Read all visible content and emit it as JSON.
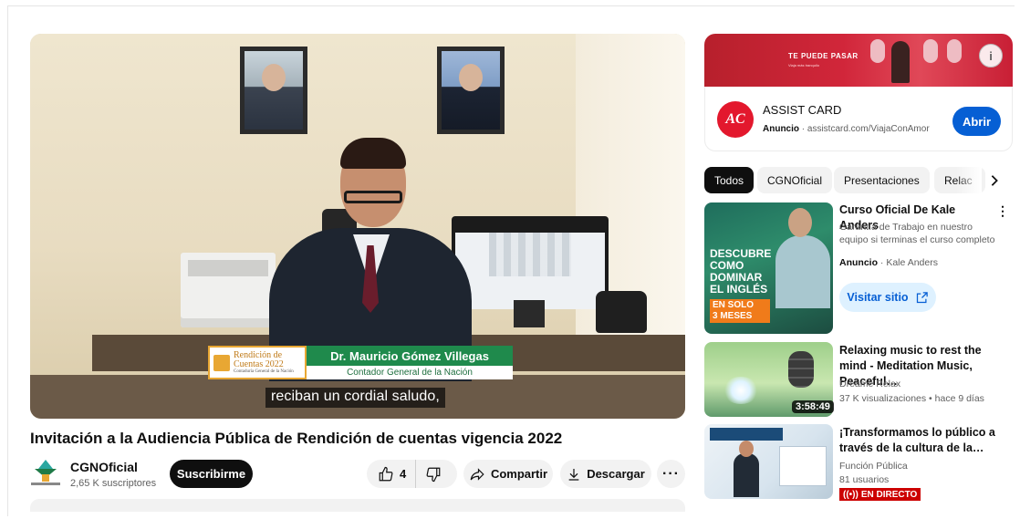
{
  "player": {
    "lower_third_logo_line1": "Rendición de",
    "lower_third_logo_line2": "Cuentas 2022",
    "lower_third_logo_sub": "Contaduría General de la Nación",
    "lower_third_name": "Dr. Mauricio Gómez Villegas",
    "lower_third_role": "Contador General de la Nación",
    "caption": "reciban un cordial saludo,"
  },
  "video": {
    "title": "Invitación a la Audiencia Pública de Rendición de cuentas vigencia 2022"
  },
  "channel": {
    "name": "CGNOficial",
    "subscribers": "2,65 K suscriptores",
    "subscribe_label": "Suscribirme"
  },
  "actions": {
    "like_count": "4",
    "share_label": "Compartir",
    "download_label": "Descargar",
    "more_label": "···"
  },
  "ad": {
    "banner_tag": "TE PUEDE PASAR",
    "banner_sub": "Viaja más tranquilo",
    "advertiser": "ASSIST CARD",
    "logo_text": "AC",
    "ad_label": "Anuncio",
    "domain": "assistcard.com/ViajaConAmor",
    "open_label": "Abrir",
    "info_label": "i"
  },
  "chips": [
    "Todos",
    "CGNOficial",
    "Presentaciones",
    "Relac"
  ],
  "recommendations": [
    {
      "title": "Curso Oficial De Kale Anders",
      "desc": "Garantía de Trabajo en nuestro equipo si terminas el curso completo",
      "ad_label": "Anuncio",
      "advertiser": "Kale Anders",
      "visit_label": "Visitar sitio",
      "thumb_lines": [
        "DESCUBRE",
        "COMO",
        "DOMINAR",
        "EL INGLÉS"
      ],
      "thumb_highlight": [
        "EN SOLO",
        "3 MESES"
      ]
    },
    {
      "title": "Relaxing music to rest the mind - Meditation Music, Peaceful…",
      "channel": "Dreame Relax",
      "meta": "37 K visualizaciones • hace 9 días",
      "duration": "3:58:49"
    },
    {
      "title": "¡Transformamos lo público a través de la cultura de la…",
      "channel": "Función Pública",
      "meta": "81 usuarios",
      "live_label": "EN DIRECTO"
    }
  ],
  "colors": {
    "accent_blue": "#065fd4",
    "live_red": "#cc0000",
    "ad_red": "#e3182d",
    "lower_third_green": "#1f8a4c"
  },
  "icons": {
    "like": "thumb-up-icon",
    "dislike": "thumb-down-icon",
    "share": "share-arrow-icon",
    "download": "download-icon",
    "chevron": "chevron-right-icon",
    "external": "external-link-icon",
    "live": "live-broadcast-icon"
  }
}
